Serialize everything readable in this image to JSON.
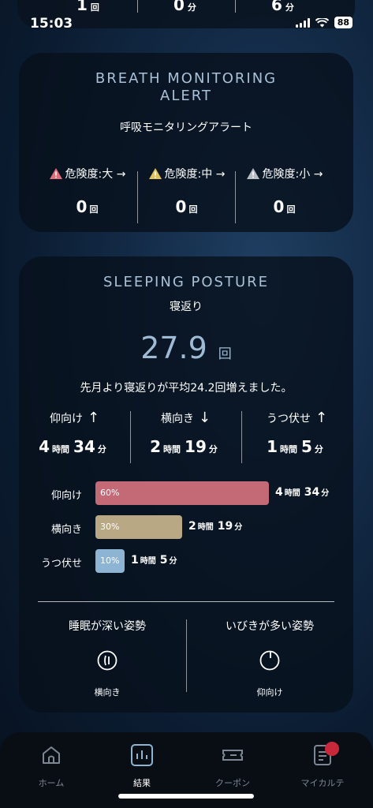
{
  "summary_strip": {
    "items": [
      {
        "value": "1",
        "unit": "回"
      },
      {
        "value": "0",
        "unit": "分"
      },
      {
        "value": "6",
        "unit": "分"
      }
    ]
  },
  "status_bar": {
    "time": "15:03",
    "battery": "88"
  },
  "breath_alert": {
    "title_en_line1": "BREATH MONITORING",
    "title_en_line2": "ALERT",
    "title_ja": "呼吸モニタリングアラート",
    "levels": [
      {
        "label": "危険度:大 →",
        "count": "0",
        "unit": "回",
        "icon_color": "#e06d7a"
      },
      {
        "label": "危険度:中 →",
        "count": "0",
        "unit": "回",
        "icon_color": "#e2c25c"
      },
      {
        "label": "危険度:小 →",
        "count": "0",
        "unit": "回",
        "icon_color": "#b9bcc2"
      }
    ]
  },
  "posture": {
    "title_en": "SLEEPING POSTURE",
    "title_ja": "寝返り",
    "turn_count": "27.9",
    "turn_unit": "回",
    "comparison_text": "先月より寝返りが平均24.2回増えました。",
    "directions": [
      {
        "label": "仰向け",
        "arrow": "↑",
        "hours": "4",
        "hour_unit": "時間",
        "minutes": "34",
        "minute_unit": "分"
      },
      {
        "label": "横向き",
        "arrow": "↓",
        "hours": "2",
        "hour_unit": "時間",
        "minutes": "19",
        "minute_unit": "分"
      },
      {
        "label": "うつ伏せ",
        "arrow": "↑",
        "hours": "1",
        "hour_unit": "時間",
        "minutes": "5",
        "minute_unit": "分"
      }
    ],
    "bars": [
      {
        "label": "仰向け",
        "percent_text": "60%",
        "percent": 60,
        "color": "#c46a76",
        "hours": "4",
        "hour_unit": "時間",
        "minutes": "34",
        "minute_unit": "分"
      },
      {
        "label": "横向き",
        "percent_text": "30%",
        "percent": 30,
        "color": "#b8a883",
        "hours": "2",
        "hour_unit": "時間",
        "minutes": "19",
        "minute_unit": "分"
      },
      {
        "label": "うつ伏せ",
        "percent_text": "10%",
        "percent": 10,
        "color": "#8eb4d4",
        "hours": "1",
        "hour_unit": "時間",
        "minutes": "5",
        "minute_unit": "分"
      }
    ],
    "features": [
      {
        "title": "睡眠が深い姿勢",
        "icon": "side-sleep-icon",
        "name": "横向き"
      },
      {
        "title": "いびきが多い姿勢",
        "icon": "back-sleep-icon",
        "name": "仰向け"
      }
    ]
  },
  "tabbar": {
    "tabs": [
      {
        "label": "ホーム",
        "icon": "home-icon"
      },
      {
        "label": "結果",
        "icon": "chart-icon"
      },
      {
        "label": "クーポン",
        "icon": "ticket-icon"
      },
      {
        "label": "マイカルテ",
        "icon": "record-icon"
      }
    ],
    "active_index": 1
  }
}
